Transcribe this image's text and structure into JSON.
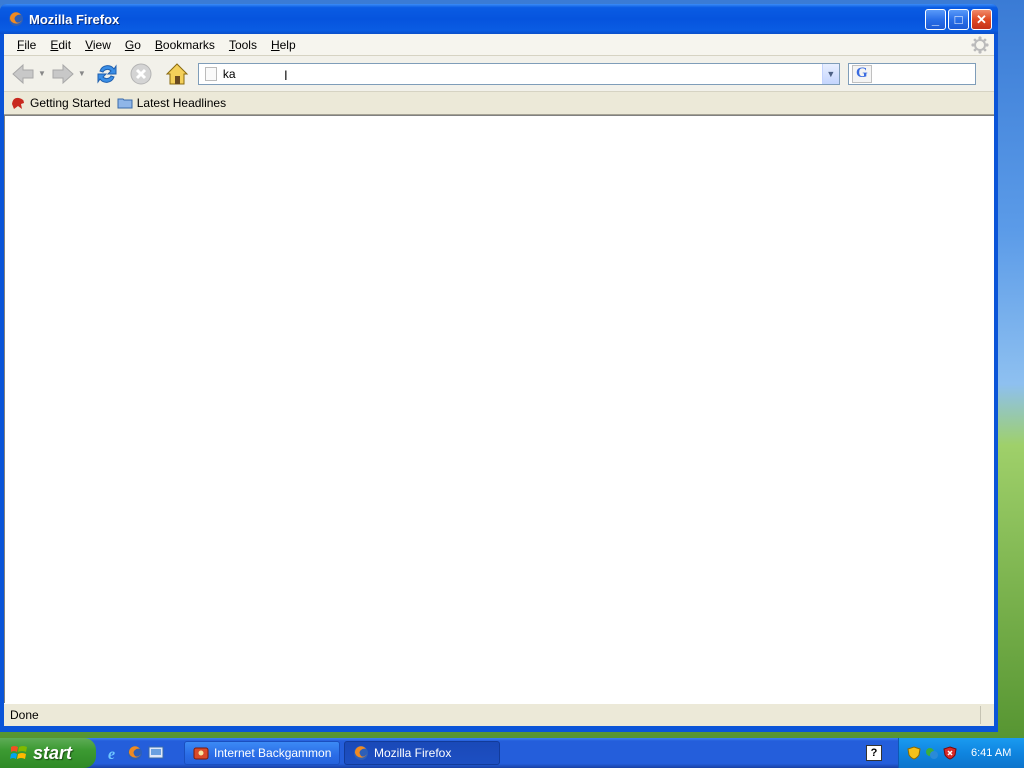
{
  "window": {
    "title": "Mozilla Firefox",
    "minimize_icon": "minimize-icon",
    "maximize_icon": "maximize-icon",
    "close_icon": "close-icon"
  },
  "menu": {
    "items": [
      {
        "label": "File",
        "accel": "F"
      },
      {
        "label": "Edit",
        "accel": "E"
      },
      {
        "label": "View",
        "accel": "V"
      },
      {
        "label": "Go",
        "accel": "G"
      },
      {
        "label": "Bookmarks",
        "accel": "B"
      },
      {
        "label": "Tools",
        "accel": "T"
      },
      {
        "label": "Help",
        "accel": "H"
      }
    ]
  },
  "toolbar": {
    "back_icon": "back-arrow-icon",
    "forward_icon": "forward-arrow-icon",
    "reload_icon": "reload-icon",
    "stop_icon": "stop-icon",
    "home_icon": "home-icon"
  },
  "address": {
    "value": "ka"
  },
  "search": {
    "engine_glyph": "G",
    "value": ""
  },
  "bookmarks": {
    "items": [
      {
        "label": "Getting Started",
        "icon": "getting-started-icon"
      },
      {
        "label": "Latest Headlines",
        "icon": "rss-folder-icon"
      }
    ]
  },
  "status": {
    "text": "Done"
  },
  "taskbar": {
    "start_label": "start",
    "tasks": [
      {
        "label": "Internet Backgammon",
        "active": false
      },
      {
        "label": "Mozilla Firefox",
        "active": true
      }
    ],
    "clock": "6:41 AM",
    "help_glyph": "?"
  },
  "colors": {
    "titlebar_blue": "#0654de",
    "chrome_beige": "#ece9d8",
    "start_green": "#3c9a32",
    "tray_blue": "#0f85e0"
  }
}
